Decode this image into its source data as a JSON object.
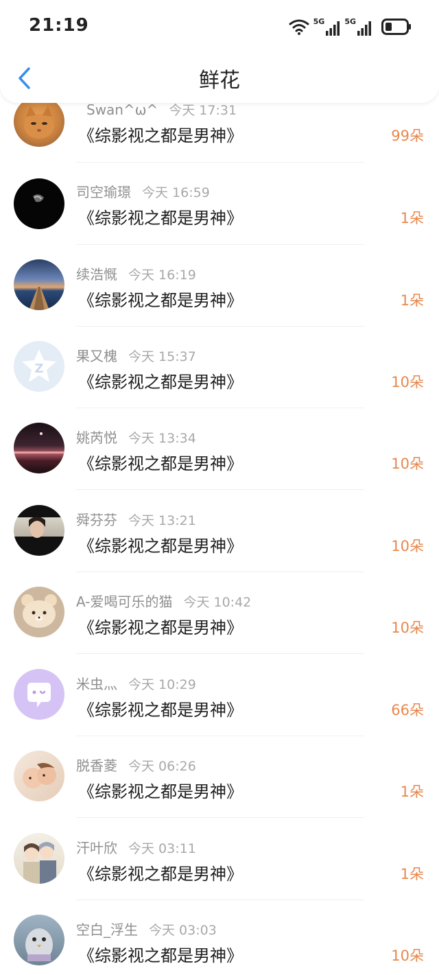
{
  "status_bar": {
    "time": "21:19",
    "wifi_icon": "wifi-icon",
    "networks": [
      "5G",
      "5G"
    ],
    "battery_icon": "battery-icon"
  },
  "nav": {
    "back_icon": "chevron-left-icon",
    "title": "鲜花"
  },
  "colors": {
    "accent_back": "#3a8ee6",
    "amount": "#e8874d",
    "name": "#8f8f8f",
    "book": "#1e1e1e"
  },
  "items": [
    {
      "name": "Swan^ω^",
      "time": "今天 17:31",
      "book": "《综影视之都是男神》",
      "amount": "99朵",
      "avatar": "cat-photo-avatar"
    },
    {
      "name": "司空瑜璟",
      "time": "今天 16:59",
      "book": "《综影视之都是男神》",
      "amount": "1朵",
      "avatar": "dark-portrait-avatar"
    },
    {
      "name": "续浩慨",
      "time": "今天 16:19",
      "book": "《综影视之都是男神》",
      "amount": "1朵",
      "avatar": "lake-pier-avatar"
    },
    {
      "name": "果又槐",
      "time": "今天 15:37",
      "book": "《综影视之都是男神》",
      "amount": "10朵",
      "avatar": "qq-default-avatar"
    },
    {
      "name": "姚芮悦",
      "time": "今天 13:34",
      "book": "《综影视之都是男神》",
      "amount": "10朵",
      "avatar": "night-city-avatar"
    },
    {
      "name": "舜芬芬",
      "time": "今天 13:21",
      "book": "《综影视之都是男神》",
      "amount": "10朵",
      "avatar": "drama-still-avatar"
    },
    {
      "name": "A-爱喝可乐的猫",
      "time": "今天 10:42",
      "book": "《综影视之都是男神》",
      "amount": "10朵",
      "avatar": "bear-avatar"
    },
    {
      "name": "米虫灬",
      "time": "今天 10:29",
      "book": "《综影视之都是男神》",
      "amount": "66朵",
      "avatar": "purple-chat-avatar"
    },
    {
      "name": "脱香菱",
      "time": "今天 06:26",
      "book": "《综影视之都是男神》",
      "amount": "1朵",
      "avatar": "babies-avatar"
    },
    {
      "name": "汗叶欣",
      "time": "今天 03:11",
      "book": "《综影视之都是男神》",
      "amount": "1朵",
      "avatar": "anime-couple-avatar"
    },
    {
      "name": "空白_浮生",
      "time": "今天 03:03",
      "book": "《综影视之都是男神》",
      "amount": "10朵",
      "avatar": "plush-toy-avatar"
    }
  ]
}
